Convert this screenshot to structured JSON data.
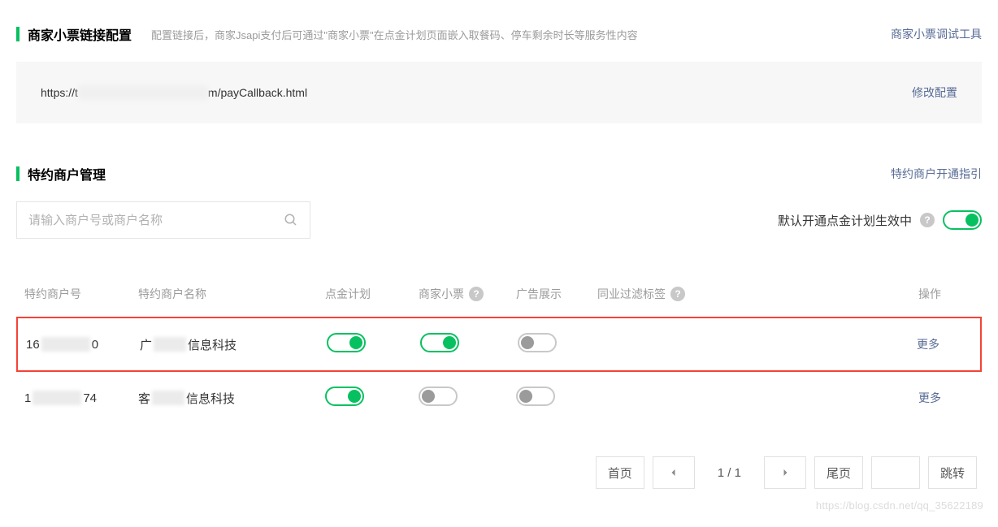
{
  "section1": {
    "title": "商家小票链接配置",
    "desc": "配置链接后，商家Jsapi支付后可通过\"商家小票\"在点金计划页面嵌入取餐码、停车剩余时长等服务性内容",
    "debug_link": "商家小票调试工具",
    "callback_prefix": "https://t",
    "callback_suffix": "m/payCallback.html",
    "edit_link": "修改配置"
  },
  "section2": {
    "title": "特约商户管理",
    "guide_link": "特约商户开通指引",
    "search_placeholder": "请输入商户号或商户名称",
    "default_toggle_label": "默认开通点金计划生效中"
  },
  "table": {
    "headers": {
      "merchant_id": "特约商户号",
      "merchant_name": "特约商户名称",
      "gold_plan": "点金计划",
      "receipt": "商家小票",
      "ads": "广告展示",
      "filter_tags": "同业过滤标签",
      "action": "操作"
    },
    "rows": [
      {
        "id_prefix": "16",
        "id_suffix": "0",
        "name_prefix": "广",
        "name_suffix": "信息科技",
        "gold_plan_on": true,
        "receipt_on": true,
        "ads_on": false,
        "action": "更多"
      },
      {
        "id_prefix": "1",
        "id_suffix": "74",
        "name_prefix": "客",
        "name_suffix": "信息科技",
        "gold_plan_on": true,
        "receipt_on": false,
        "ads_on": false,
        "action": "更多"
      }
    ]
  },
  "pagination": {
    "first": "首页",
    "last": "尾页",
    "info": "1 / 1",
    "jump": "跳转"
  },
  "watermark": "https://blog.csdn.net/qq_35622189"
}
